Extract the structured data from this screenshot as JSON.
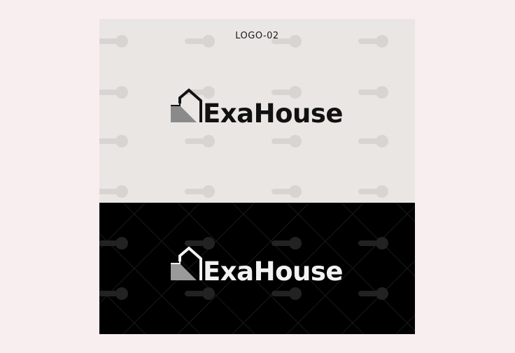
{
  "version_label": "LOGO-02",
  "logo_light": {
    "name": "ExaHouse",
    "ink_color": "#111111",
    "roof_shade_color": "#8a8a8a",
    "background_color": "#eae6e3"
  },
  "logo_dark": {
    "name": "ExaHouse",
    "ink_color": "#f2f2f2",
    "roof_shade_color": "#9a9a9a",
    "background_color": "#000000"
  },
  "watermark_icon": "stamp-icon"
}
